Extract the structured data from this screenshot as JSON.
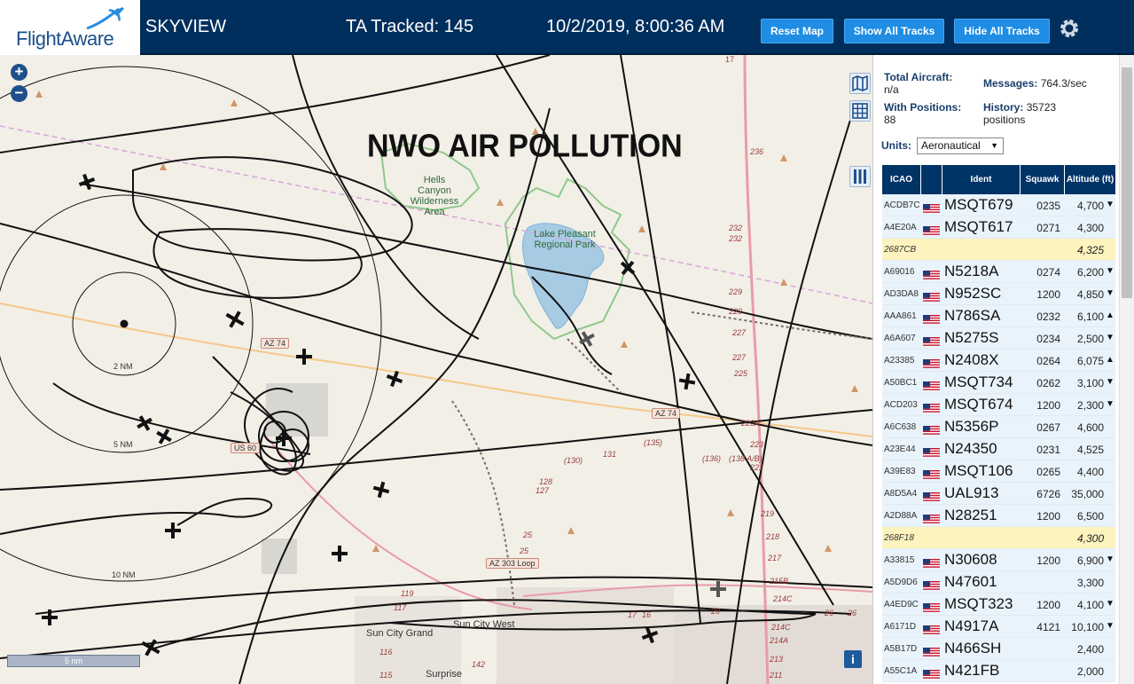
{
  "header": {
    "logo_text": "FlightAware",
    "app_name": "SKYVIEW",
    "tracked_label": "TA Tracked: 145",
    "datetime": "10/2/2019, 8:00:36 AM",
    "reset_map_label": "Reset Map",
    "show_all_label": "Show All Tracks",
    "hide_all_label": "Hide All Tracks",
    "colors": {
      "bar": "#002f5d",
      "button": "#1e8de3"
    }
  },
  "map": {
    "overlay_title": "NWO AIR POLLUTION",
    "zoom_in": "+",
    "zoom_out": "−",
    "scale_label": "5 nm",
    "info_label": "i",
    "range_rings": [
      "2 NM",
      "5 NM",
      "10 NM"
    ],
    "road_labels": [
      "AZ 74",
      "AZ 74",
      "US 60",
      "AZ 303 Loop"
    ],
    "park_labels": {
      "hells_canyon": "Hells Canyon Wilderness Area",
      "lake_pleasant": "Lake Pleasant Regional Park"
    },
    "town_labels": [
      "Sun City Grand",
      "Sun City West",
      "Surprise"
    ],
    "highway_numbers": [
      "17",
      "236",
      "232",
      "232",
      "229",
      "229",
      "227",
      "227",
      "225",
      "223A",
      "223",
      "221",
      "219",
      "218",
      "217",
      "215B",
      "214C",
      "214A",
      "214C",
      "213",
      "211",
      "119",
      "117",
      "116",
      "115",
      "142",
      "128",
      "127",
      "(130)",
      "131",
      "(135)",
      "(136)",
      "(138 A/B)",
      "25",
      "25",
      "17",
      "16",
      "20",
      "26",
      "26"
    ]
  },
  "panel": {
    "total_aircraft_label": "Total Aircraft:",
    "total_aircraft_value": "n/a",
    "with_positions_label": "With Positions:",
    "with_positions_value": "88",
    "messages_label": "Messages:",
    "messages_value": "764.3/sec",
    "history_label": "History:",
    "history_value": "35723",
    "history_unit": "positions",
    "units_label": "Units:",
    "units_value": "Aeronautical",
    "columns": [
      "ICAO",
      "",
      "Ident",
      "Squawk",
      "Altitude (ft)"
    ],
    "rows": [
      {
        "icao": "ACDB7C",
        "flag": true,
        "ident": "MSQT679",
        "squawk": "0235",
        "alt": "4,700",
        "trend": "▼",
        "hl": false
      },
      {
        "icao": "A4E20A",
        "flag": true,
        "ident": "MSQT617",
        "squawk": "0271",
        "alt": "4,300",
        "trend": "",
        "hl": false
      },
      {
        "icao": "2687CB",
        "flag": false,
        "ident": "",
        "squawk": "",
        "alt": "4,325",
        "trend": "",
        "hl": true
      },
      {
        "icao": "A69016",
        "flag": true,
        "ident": "N5218A",
        "squawk": "0274",
        "alt": "6,200",
        "trend": "▼",
        "hl": false
      },
      {
        "icao": "AD3DA8",
        "flag": true,
        "ident": "N952SC",
        "squawk": "1200",
        "alt": "4,850",
        "trend": "▼",
        "hl": false
      },
      {
        "icao": "AAA861",
        "flag": true,
        "ident": "N786SA",
        "squawk": "0232",
        "alt": "6,100",
        "trend": "▲",
        "hl": false
      },
      {
        "icao": "A6A607",
        "flag": true,
        "ident": "N5275S",
        "squawk": "0234",
        "alt": "2,500",
        "trend": "▼",
        "hl": false
      },
      {
        "icao": "A23385",
        "flag": true,
        "ident": "N2408X",
        "squawk": "0264",
        "alt": "6,075",
        "trend": "▲",
        "hl": false
      },
      {
        "icao": "A50BC1",
        "flag": true,
        "ident": "MSQT734",
        "squawk": "0262",
        "alt": "3,100",
        "trend": "▼",
        "hl": false
      },
      {
        "icao": "ACD203",
        "flag": true,
        "ident": "MSQT674",
        "squawk": "1200",
        "alt": "2,300",
        "trend": "▼",
        "hl": false
      },
      {
        "icao": "A6C638",
        "flag": true,
        "ident": "N5356P",
        "squawk": "0267",
        "alt": "4,600",
        "trend": "",
        "hl": false
      },
      {
        "icao": "A23E44",
        "flag": true,
        "ident": "N24350",
        "squawk": "0231",
        "alt": "4,525",
        "trend": "",
        "hl": false
      },
      {
        "icao": "A39E83",
        "flag": true,
        "ident": "MSQT106",
        "squawk": "0265",
        "alt": "4,400",
        "trend": "",
        "hl": false
      },
      {
        "icao": "A8D5A4",
        "flag": true,
        "ident": "UAL913",
        "squawk": "6726",
        "alt": "35,000",
        "trend": "",
        "hl": false
      },
      {
        "icao": "A2D88A",
        "flag": true,
        "ident": "N28251",
        "squawk": "1200",
        "alt": "6,500",
        "trend": "",
        "hl": false
      },
      {
        "icao": "268F18",
        "flag": false,
        "ident": "",
        "squawk": "",
        "alt": "4,300",
        "trend": "",
        "hl": true
      },
      {
        "icao": "A33815",
        "flag": true,
        "ident": "N30608",
        "squawk": "1200",
        "alt": "6,900",
        "trend": "▼",
        "hl": false
      },
      {
        "icao": "A5D9D6",
        "flag": true,
        "ident": "N47601",
        "squawk": "",
        "alt": "3,300",
        "trend": "",
        "hl": false
      },
      {
        "icao": "A4ED9C",
        "flag": true,
        "ident": "MSQT323",
        "squawk": "1200",
        "alt": "4,100",
        "trend": "▼",
        "hl": false
      },
      {
        "icao": "A6171D",
        "flag": true,
        "ident": "N4917A",
        "squawk": "4121",
        "alt": "10,100",
        "trend": "▼",
        "hl": false
      },
      {
        "icao": "A5B17D",
        "flag": true,
        "ident": "N466SH",
        "squawk": "",
        "alt": "2,400",
        "trend": "",
        "hl": false
      },
      {
        "icao": "A55C1A",
        "flag": true,
        "ident": "N421FB",
        "squawk": "",
        "alt": "2,000",
        "trend": "",
        "hl": false
      }
    ]
  }
}
